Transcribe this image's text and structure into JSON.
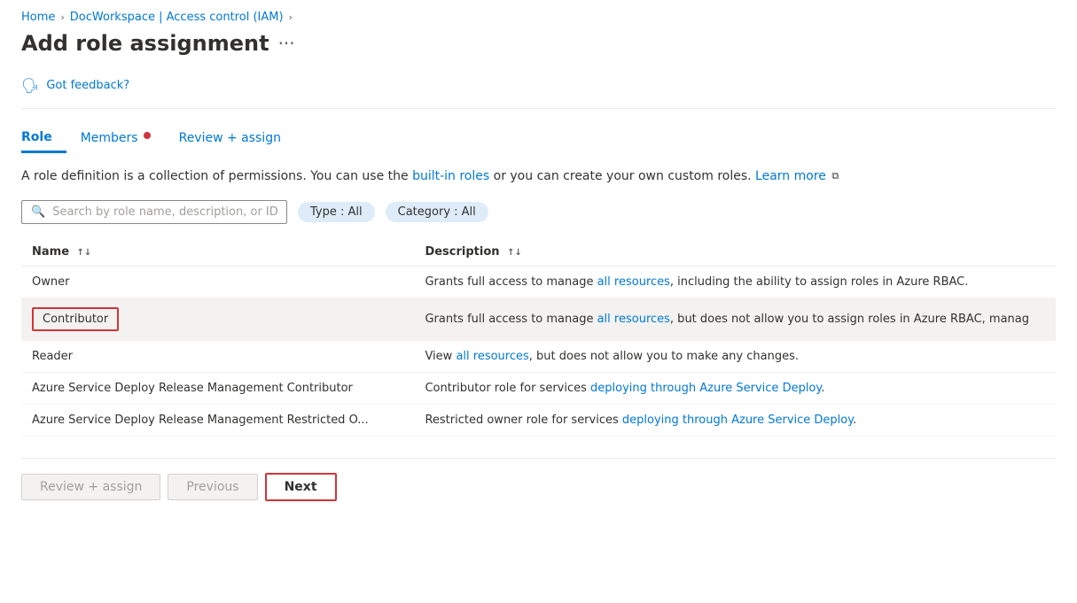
{
  "breadcrumb": {
    "home": "Home",
    "workspace": "DocWorkspace | Access control (IAM)",
    "separator": "›"
  },
  "page_title": "Add role assignment",
  "ellipsis": "···",
  "feedback": {
    "icon": "👤",
    "text": "Got feedback?"
  },
  "tabs": [
    {
      "id": "role",
      "label": "Role",
      "active": true,
      "dot": false
    },
    {
      "id": "members",
      "label": "Members",
      "active": false,
      "dot": true
    },
    {
      "id": "review",
      "label": "Review + assign",
      "active": false,
      "dot": false
    }
  ],
  "description": {
    "text_before": "A role definition is a collection of permissions. You can use the ",
    "link_text": "built-in roles",
    "text_middle": " or you can create your own custom roles. ",
    "learn_more": "Learn more",
    "external_icon": "⧉"
  },
  "search": {
    "placeholder": "Search by role name, description, or ID"
  },
  "filters": [
    {
      "id": "type",
      "label": "Type : All"
    },
    {
      "id": "category",
      "label": "Category : All"
    }
  ],
  "table": {
    "columns": [
      {
        "id": "name",
        "label": "Name",
        "sort": true
      },
      {
        "id": "description",
        "label": "Description",
        "sort": true
      }
    ],
    "rows": [
      {
        "id": "owner",
        "name": "Owner",
        "description_before": "Grants full access to manage ",
        "description_link": "all resources",
        "description_after": ", including the ability to assign roles in Azure RBAC.",
        "selected": false,
        "highlighted": false
      },
      {
        "id": "contributor",
        "name": "Contributor",
        "description_before": "Grants full access to manage ",
        "description_link": "all resources",
        "description_after": ", but does not allow you to assign roles in Azure RBAC, manag",
        "selected": true,
        "highlighted": true
      },
      {
        "id": "reader",
        "name": "Reader",
        "description_before": "View ",
        "description_link": "all resources",
        "description_after": ", but does not allow you to make any changes.",
        "selected": false,
        "highlighted": false
      },
      {
        "id": "azure-service-deploy-mgmt",
        "name": "Azure Service Deploy Release Management Contributor",
        "description_before": "Contributor role for services ",
        "description_link": "deploying through Azure Service Deploy",
        "description_after": ".",
        "selected": false,
        "highlighted": false
      },
      {
        "id": "azure-service-deploy-restricted",
        "name": "Azure Service Deploy Release Management Restricted O...",
        "description_before": "Restricted owner role for services ",
        "description_link": "deploying through Azure Service Deploy",
        "description_after": ".",
        "selected": false,
        "highlighted": false
      }
    ]
  },
  "footer": {
    "review_assign_label": "Review + assign",
    "previous_label": "Previous",
    "next_label": "Next"
  }
}
